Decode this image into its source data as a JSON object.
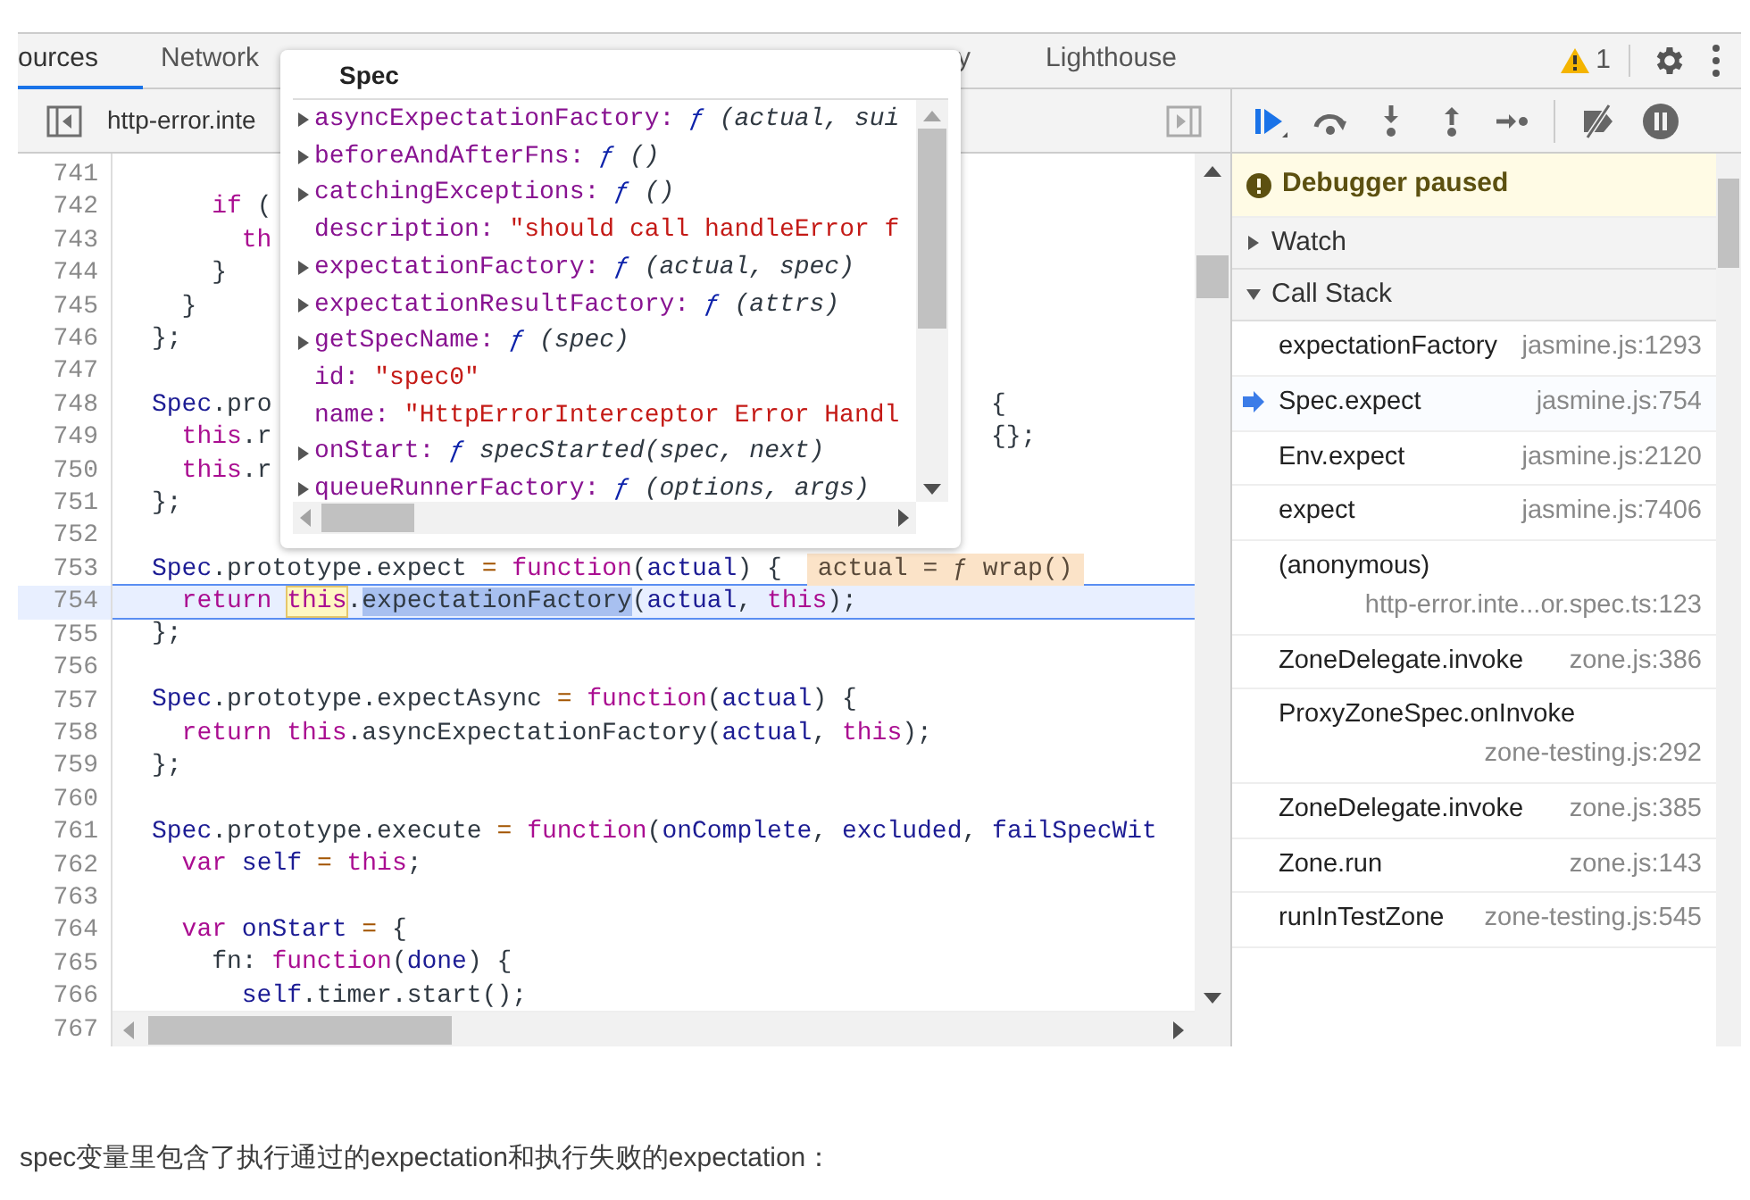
{
  "tabs": [
    {
      "label": "ources",
      "selected": true
    },
    {
      "label": "Network",
      "selected": false
    },
    {
      "label": "y",
      "selected": false
    },
    {
      "label": "Lighthouse",
      "selected": false
    }
  ],
  "warning_count": "1",
  "file_tab": {
    "label": "http-error.inte"
  },
  "code": {
    "lines": [
      {
        "number": "741"
      },
      {
        "number": "742",
        "tokens": [
          {
            "kind": "kw",
            "text": "    if"
          },
          {
            "kind": "plain",
            "text": " ("
          }
        ]
      },
      {
        "number": "743",
        "tokens": [
          {
            "kind": "kw",
            "text": "      th"
          }
        ]
      },
      {
        "number": "744",
        "tokens": [
          {
            "kind": "plain",
            "text": "    }"
          }
        ]
      },
      {
        "number": "745",
        "tokens": [
          {
            "kind": "plain",
            "text": "  }"
          }
        ]
      },
      {
        "number": "746",
        "tokens": [
          {
            "kind": "plain",
            "text": "};"
          }
        ]
      },
      {
        "number": "747"
      },
      {
        "number": "748",
        "tokens": [
          {
            "kind": "var",
            "text": "Spec"
          },
          {
            "kind": "plain",
            "text": ".pro"
          }
        ],
        "right": [
          {
            "kind": "plain",
            "text": "{"
          }
        ]
      },
      {
        "number": "749",
        "tokens": [
          {
            "kind": "kw",
            "text": "  this"
          },
          {
            "kind": "plain",
            "text": ".r"
          }
        ],
        "right": [
          {
            "kind": "plain",
            "text": "{};"
          }
        ]
      },
      {
        "number": "750",
        "tokens": [
          {
            "kind": "kw",
            "text": "  this"
          },
          {
            "kind": "plain",
            "text": ".r"
          }
        ]
      },
      {
        "number": "751",
        "tokens": [
          {
            "kind": "plain",
            "text": "};"
          }
        ]
      },
      {
        "number": "752"
      },
      {
        "number": "753",
        "tokens": [
          {
            "kind": "var",
            "text": "Spec"
          },
          {
            "kind": "plain",
            "text": ".prototype.expect "
          },
          {
            "kind": "op",
            "text": "= "
          },
          {
            "kind": "kw",
            "text": "function"
          },
          {
            "kind": "plain",
            "text": "("
          },
          {
            "kind": "var",
            "text": "actual"
          },
          {
            "kind": "plain",
            "text": ") {"
          }
        ],
        "inline_value": "actual = ƒ wrap()"
      },
      {
        "number": "754",
        "current": true,
        "tokens": [
          {
            "kind": "kw",
            "text": "  return "
          },
          {
            "kind": "kw",
            "text": "this",
            "hovered": true
          },
          {
            "kind": "plain",
            "text": "."
          },
          {
            "kind": "plain",
            "text": "expectationFactory",
            "selected": true
          },
          {
            "kind": "plain",
            "text": "("
          },
          {
            "kind": "var",
            "text": "actual"
          },
          {
            "kind": "plain",
            "text": ", "
          },
          {
            "kind": "kw",
            "text": "this"
          },
          {
            "kind": "plain",
            "text": ");"
          }
        ]
      },
      {
        "number": "755",
        "tokens": [
          {
            "kind": "plain",
            "text": "};"
          }
        ]
      },
      {
        "number": "756"
      },
      {
        "number": "757",
        "tokens": [
          {
            "kind": "var",
            "text": "Spec"
          },
          {
            "kind": "plain",
            "text": ".prototype.expectAsync "
          },
          {
            "kind": "op",
            "text": "= "
          },
          {
            "kind": "kw",
            "text": "function"
          },
          {
            "kind": "plain",
            "text": "("
          },
          {
            "kind": "var",
            "text": "actual"
          },
          {
            "kind": "plain",
            "text": ") {"
          }
        ]
      },
      {
        "number": "758",
        "tokens": [
          {
            "kind": "kw",
            "text": "  return this"
          },
          {
            "kind": "plain",
            "text": ".asyncExpectationFactory("
          },
          {
            "kind": "var",
            "text": "actual"
          },
          {
            "kind": "plain",
            "text": ", "
          },
          {
            "kind": "kw",
            "text": "this"
          },
          {
            "kind": "plain",
            "text": ");"
          }
        ]
      },
      {
        "number": "759",
        "tokens": [
          {
            "kind": "plain",
            "text": "};"
          }
        ]
      },
      {
        "number": "760"
      },
      {
        "number": "761",
        "tokens": [
          {
            "kind": "var",
            "text": "Spec"
          },
          {
            "kind": "plain",
            "text": ".prototype.execute "
          },
          {
            "kind": "op",
            "text": "= "
          },
          {
            "kind": "kw",
            "text": "function"
          },
          {
            "kind": "plain",
            "text": "("
          },
          {
            "kind": "var",
            "text": "onComplete"
          },
          {
            "kind": "plain",
            "text": ", "
          },
          {
            "kind": "var",
            "text": "excluded"
          },
          {
            "kind": "plain",
            "text": ", "
          },
          {
            "kind": "var",
            "text": "failSpecWit"
          }
        ]
      },
      {
        "number": "762",
        "tokens": [
          {
            "kind": "kw",
            "text": "  var "
          },
          {
            "kind": "var",
            "text": "self "
          },
          {
            "kind": "op",
            "text": "= "
          },
          {
            "kind": "kw",
            "text": "this"
          },
          {
            "kind": "plain",
            "text": ";"
          }
        ]
      },
      {
        "number": "763"
      },
      {
        "number": "764",
        "tokens": [
          {
            "kind": "kw",
            "text": "  var "
          },
          {
            "kind": "var",
            "text": "onStart "
          },
          {
            "kind": "op",
            "text": "="
          },
          {
            "kind": "plain",
            "text": " {"
          }
        ]
      },
      {
        "number": "765",
        "tokens": [
          {
            "kind": "plain",
            "text": "    fn: "
          },
          {
            "kind": "kw",
            "text": "function"
          },
          {
            "kind": "plain",
            "text": "("
          },
          {
            "kind": "var",
            "text": "done"
          },
          {
            "kind": "plain",
            "text": ") {"
          }
        ]
      },
      {
        "number": "766",
        "tokens": [
          {
            "kind": "var",
            "text": "      self"
          },
          {
            "kind": "plain",
            "text": ".timer.start();"
          }
        ]
      },
      {
        "number": "767"
      }
    ]
  },
  "popover": {
    "title": "Spec",
    "items": [
      {
        "kind": "fn",
        "key": "asyncExpectationFactory:",
        "marker": "ƒ",
        "value": "(actual, sui"
      },
      {
        "kind": "fn",
        "key": "beforeAndAfterFns:",
        "marker": "ƒ",
        "value": "()"
      },
      {
        "kind": "fn",
        "key": "catchingExceptions:",
        "marker": "ƒ",
        "value": "()"
      },
      {
        "kind": "string",
        "key": "description:",
        "value": "\"should call handleError f"
      },
      {
        "kind": "fn",
        "key": "expectationFactory:",
        "marker": "ƒ",
        "value": "(actual, spec)"
      },
      {
        "kind": "fn",
        "key": "expectationResultFactory:",
        "marker": "ƒ",
        "value": "(attrs)"
      },
      {
        "kind": "fn",
        "key": "getSpecName:",
        "marker": "ƒ",
        "value": "(spec)"
      },
      {
        "kind": "string",
        "key": "id:",
        "value": "\"spec0\""
      },
      {
        "kind": "string",
        "key": "name:",
        "value": "\"HttpErrorInterceptor Error Handl"
      },
      {
        "kind": "fn",
        "key": "onStart:",
        "marker": "ƒ",
        "value": "specStarted(spec, next)"
      },
      {
        "kind": "fn",
        "key": "queueRunnerFactory:",
        "marker": "ƒ",
        "value": "(options, args)"
      }
    ]
  },
  "debugger_banner": "Debugger paused",
  "sections": [
    {
      "label": "Watch",
      "expanded": false
    },
    {
      "label": "Call Stack",
      "expanded": true
    }
  ],
  "call_stack": [
    {
      "name": "expectationFactory",
      "location": "jasmine.js:1293",
      "selected": false
    },
    {
      "name": "Spec.expect",
      "location": "jasmine.js:754",
      "selected": true
    },
    {
      "name": "Env.expect",
      "location": "jasmine.js:2120",
      "selected": false
    },
    {
      "name": "expect",
      "location": "jasmine.js:7406",
      "selected": false
    },
    {
      "name": "(anonymous)",
      "location": "http-error.inte...or.spec.ts:123",
      "selected": false
    },
    {
      "name": "ZoneDelegate.invoke",
      "location": "zone.js:386",
      "selected": false
    },
    {
      "name": "ProxyZoneSpec.onInvoke",
      "location": "zone-testing.js:292",
      "selected": false
    },
    {
      "name": "ZoneDelegate.invoke",
      "location": "zone.js:385",
      "selected": false
    },
    {
      "name": "Zone.run",
      "location": "zone.js:143",
      "selected": false
    },
    {
      "name": "runInTestZone",
      "location": "zone-testing.js:545",
      "selected": false
    }
  ],
  "caption": "spec变量里包含了执行通过的expectation和执行失败的expectation："
}
